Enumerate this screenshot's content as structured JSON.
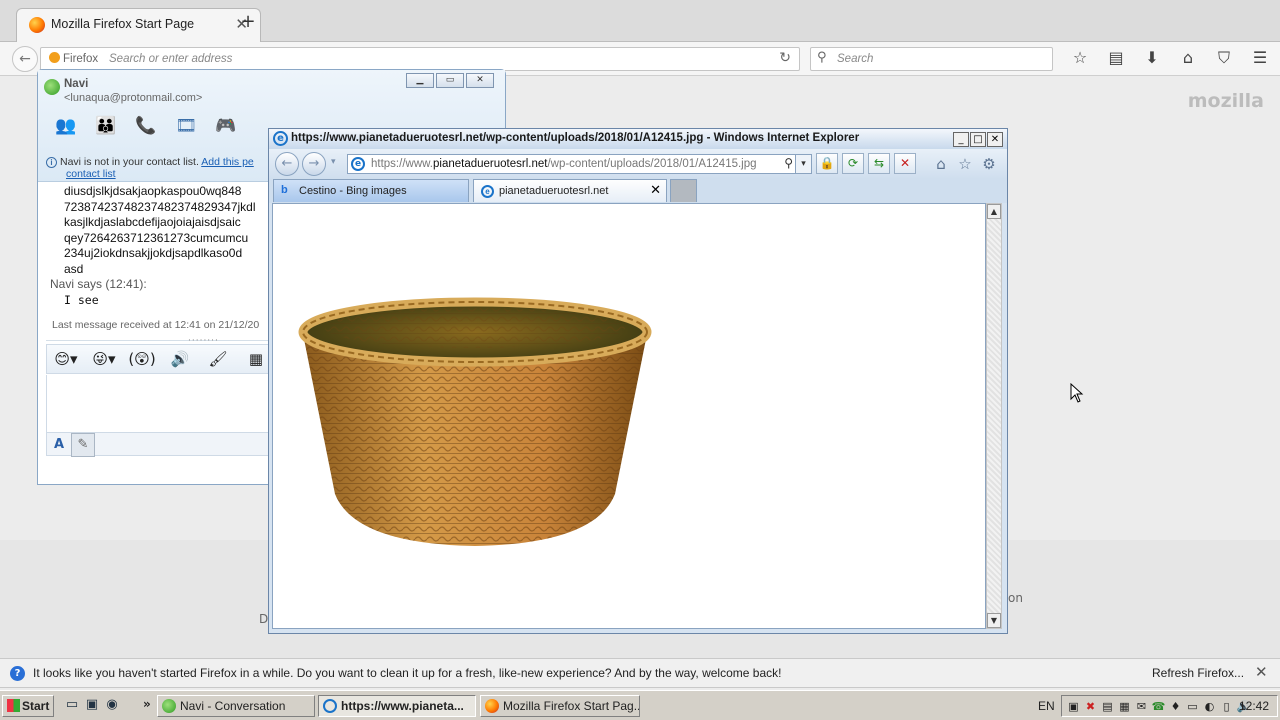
{
  "firefox": {
    "tab_title": "Mozilla Firefox Start Page",
    "tab_close": "✕",
    "new_tab": "+",
    "back": "←",
    "identity_label": "Firefox",
    "url_placeholder": "Search or enter address",
    "reload": "↻",
    "search_placeholder": "Search",
    "toolbar_icons": [
      "☆",
      "▤",
      "⬇",
      "⌂",
      "⛉",
      "☰"
    ],
    "brand_word": "mozilla",
    "content_fragment_left": "D",
    "content_fragment_right": "on",
    "notification": {
      "message": "It looks like you haven't started Firefox in a while. Do you want to clean it up for a fresh, like-new experience? And by the way, welcome back!",
      "refresh_label": "Refresh Firefox...",
      "close": "✕"
    }
  },
  "messenger": {
    "contact_name": "Navi",
    "contact_email": "<lunaqua@protonmail.com>",
    "window_buttons": [
      "▁",
      "▭",
      "✕"
    ],
    "toolbar_icons": [
      "👥",
      "👪",
      "📞",
      "🎞",
      "🎮"
    ],
    "info_text": "Navi is not in your contact list.",
    "info_link": "Add this pe",
    "info_link2": "contact list",
    "conversation_lines": [
      "diusdjslkjdsakjaopkaspou0wq848",
      "72387423748237482374829347jkdl",
      "kasjlkdjaslabcdefijaojoiajaisdjsaic",
      "qey7264263712361273cumcumcu",
      "234uj2iokdnsakjjokdjsapdlkaso0d",
      "asd"
    ],
    "says_line": "Navi says (12:41):",
    "reply": "I see",
    "last_message": "Last message received at 12:41 on 21/12/20",
    "grip": "········",
    "format_icons": [
      "😊▾",
      "😜▾",
      "(😲)",
      "🔊",
      "🖌",
      "▦",
      "🎵"
    ],
    "input_tools": [
      "A",
      "✎"
    ]
  },
  "ie": {
    "title": "https://www.pianetadueruotesrl.net/wp-content/uploads/2018/01/A12415.jpg - Windows Internet Explorer",
    "window_buttons": [
      "_",
      "□",
      "✕"
    ],
    "back": "←",
    "forward": "→",
    "history_dropdown": "▾",
    "address_prefix": "https://www.",
    "address_domain": "pianetadueruotesrl.net",
    "address_path": "/wp-content/uploads/2018/01/A12415.jpg",
    "address_search": "⚲",
    "address_dropdown": "▾",
    "nav_buttons": [
      "🔒",
      "⟳",
      "⇆",
      "✕"
    ],
    "right_icons": [
      "⌂",
      "☆",
      "⚙"
    ],
    "tabs": [
      {
        "icon": "b",
        "label": "Cestino - Bing images"
      },
      {
        "icon": "e",
        "label": "pianetadueruotesrl.net",
        "close": "✕"
      }
    ],
    "scroll_up": "▲",
    "scroll_down": "▼"
  },
  "taskbar": {
    "start_label": "Start",
    "quick_launch": [
      "▭",
      "▣",
      "◉"
    ],
    "more": "»",
    "buttons": [
      "Navi - Conversation",
      "https://www.pianeta...",
      "Mozilla Firefox Start Pag..."
    ],
    "language": "EN",
    "tray_icons": [
      "▣",
      "✖",
      "▤",
      "▦",
      "✉",
      "☎",
      "♦",
      "▭",
      "◐",
      "▯",
      "🔊"
    ],
    "clock": "12:42"
  },
  "colors": {
    "ie_title_bar": "#c8d9ec",
    "messenger_header": "#dbe9f5",
    "taskbar": "#d4d0c8",
    "link": "#1a5fb4"
  }
}
